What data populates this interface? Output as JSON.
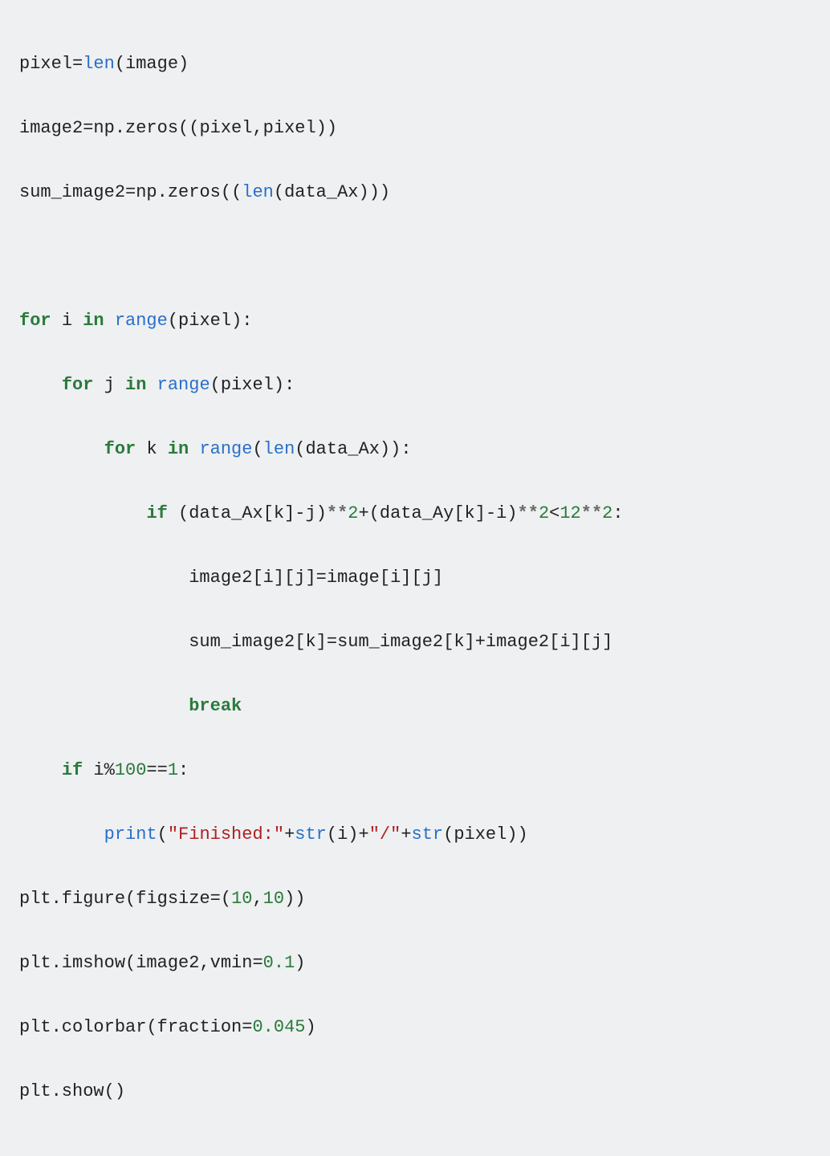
{
  "code": {
    "tokens": {
      "pixel": "pixel",
      "eq": "=",
      "len": "len",
      "image": "image",
      "image2": "image2",
      "np_zeros": "np.zeros",
      "sum_image2": "sum_image2",
      "data_Ax": "data_Ax",
      "data_Ay": "data_Ay",
      "for": "for",
      "in": "in",
      "if": "if",
      "break": "break",
      "range": "range",
      "i": "i",
      "j": "j",
      "k": "k",
      "star2": "**",
      "plus": "+",
      "minus": "-",
      "lt": "<",
      "mod": "%",
      "dbleq": "==",
      "n2": "2",
      "n12": "12",
      "n100": "100",
      "n1": "1",
      "n10": "10",
      "n0_1": "0.1",
      "n0_045": "0.045",
      "print": "print",
      "str": "str",
      "finished": "\"Finished:\"",
      "slash": "\"/\"",
      "plt_figure": "plt.figure",
      "figsize": "figsize",
      "plt_imshow": "plt.imshow",
      "vmin": "vmin",
      "plt_colorbar": "plt.colorbar",
      "fraction": "fraction",
      "plt_show": "plt.show",
      "lp": "(",
      "rp": ")",
      "comma": ",",
      "lb": "[",
      "rb": "]",
      "colon": ":"
    }
  }
}
